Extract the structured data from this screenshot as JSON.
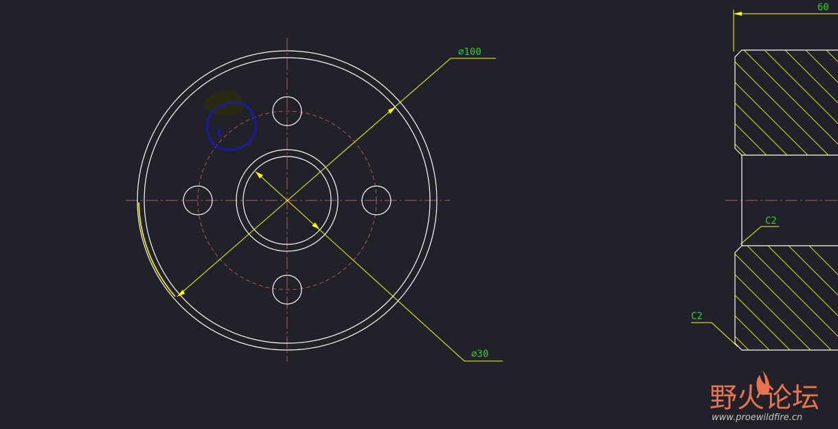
{
  "drawing": {
    "front_view": {
      "outer_diameter_label": "∅100",
      "inner_diameter_label": "∅30"
    },
    "section_view": {
      "length_label": "60",
      "chamfer_inner_label": "C2",
      "chamfer_outer_label": "C2"
    }
  },
  "watermark": {
    "forum_name": "野火论坛",
    "url": "www.proewildfire.cn"
  },
  "colors": {
    "background": "#212129",
    "geometry": "#ffffff",
    "dimension": "#ffff00",
    "center_line": "#b05a5a",
    "dimension_text": "#33cc33",
    "markup_circle": "#1a1aa8",
    "watermark": "#e8734e"
  }
}
